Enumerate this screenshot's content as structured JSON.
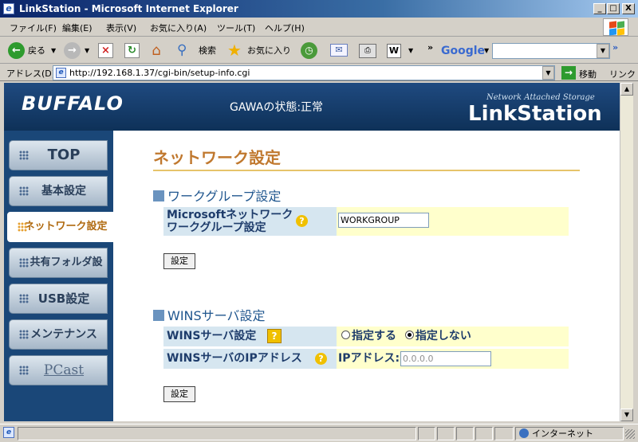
{
  "window": {
    "title": "LinkStation - Microsoft Internet Explorer",
    "minimize": "_",
    "maximize": "□",
    "close": "X"
  },
  "menu": [
    "ファイル(F)",
    "編集(E)",
    "表示(V)",
    "お気に入り(A)",
    "ツール(T)",
    "ヘルプ(H)"
  ],
  "toolbar": {
    "back": "戻る",
    "search": "検索",
    "favorites": "お気に入り",
    "more": "»",
    "google": "Google",
    "google_more": "»"
  },
  "address": {
    "label": "アドレス(D)",
    "url": "http://192.168.1.37/cgi-bin/setup-info.cgi",
    "go": "移動",
    "links": "リンク"
  },
  "header": {
    "brand": "BUFFALO",
    "status": "GAWAの状態:正常",
    "nas_label": "Network Attached Storage",
    "product": "LinkStation"
  },
  "nav": [
    {
      "label": "TOP",
      "active": false
    },
    {
      "label": "基本設定",
      "active": false
    },
    {
      "label": "ネットワーク設定",
      "active": true
    },
    {
      "label": "共有フォルダ設定",
      "active": false
    },
    {
      "label": "USB設定",
      "active": false
    },
    {
      "label": "メンテナンス",
      "active": false
    },
    {
      "label": "PCast",
      "active": false
    }
  ],
  "page": {
    "title": "ネットワーク設定",
    "workgroup": {
      "section": "ワークグループ設定",
      "label_line1": "Microsoftネットワーク",
      "label_line2": "ワークグループ設定",
      "value": "WORKGROUP",
      "button": "設定"
    },
    "wins": {
      "section": "WINSサーバ設定",
      "server_label": "WINSサーバ設定",
      "option_on": "指定する",
      "option_off": "指定しない",
      "selected": "指定しない",
      "ip_label": "WINSサーバのIPアドレス",
      "ip_prefix": "IPアドレス:",
      "ip_value": "0.0.0.0",
      "button": "設定"
    }
  },
  "statusbar": {
    "zone": "インターネット"
  },
  "colors": {
    "header": "#1f4a80",
    "accent": "#c0782e",
    "label_bg": "#d6e6f0",
    "value_bg": "#ffffcc"
  }
}
